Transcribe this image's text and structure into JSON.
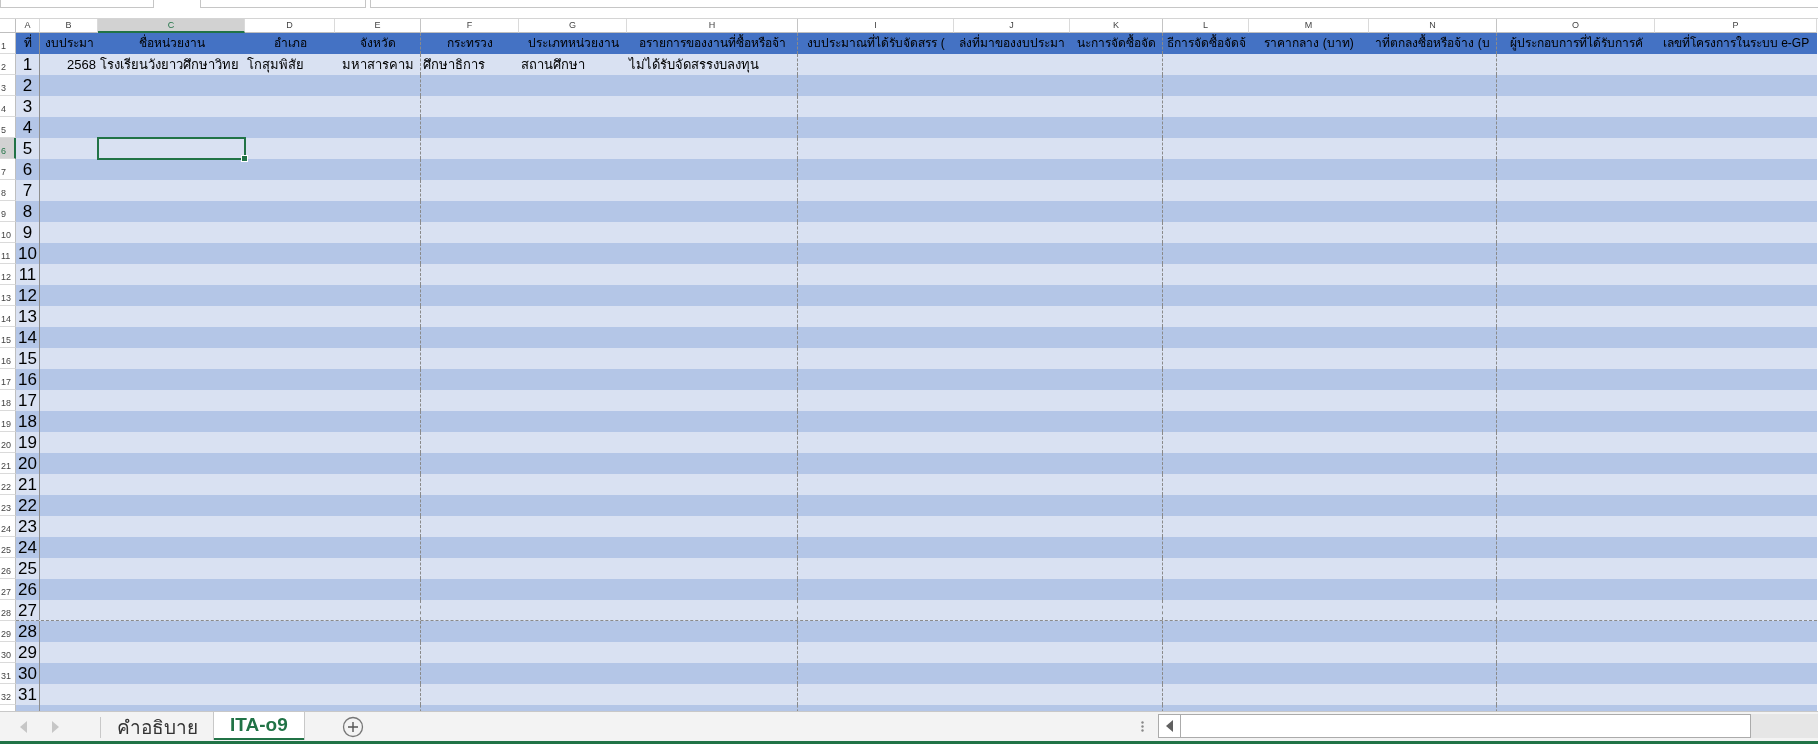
{
  "columns": [
    {
      "letter": "A",
      "selected": false,
      "page_break_after": false
    },
    {
      "letter": "B",
      "selected": false,
      "page_break_after": false
    },
    {
      "letter": "C",
      "selected": true,
      "page_break_after": false
    },
    {
      "letter": "D",
      "selected": false,
      "page_break_after": false
    },
    {
      "letter": "E",
      "selected": false,
      "page_break_after": true
    },
    {
      "letter": "F",
      "selected": false,
      "page_break_after": false
    },
    {
      "letter": "G",
      "selected": false,
      "page_break_after": false
    },
    {
      "letter": "H",
      "selected": false,
      "page_break_after": true
    },
    {
      "letter": "I",
      "selected": false,
      "page_break_after": false
    },
    {
      "letter": "J",
      "selected": false,
      "page_break_after": false
    },
    {
      "letter": "K",
      "selected": false,
      "page_break_after": true
    },
    {
      "letter": "L",
      "selected": false,
      "page_break_after": false
    },
    {
      "letter": "M",
      "selected": false,
      "page_break_after": false
    },
    {
      "letter": "N",
      "selected": false,
      "page_break_after": true
    },
    {
      "letter": "O",
      "selected": false,
      "page_break_after": false
    },
    {
      "letter": "P",
      "selected": false,
      "page_break_after": false
    }
  ],
  "rows": [
    {
      "number": "1",
      "kind": "header",
      "selected": false,
      "page_break_after": false,
      "cells": [
        "ที่",
        "งบประมา",
        "ชื่อหน่วยงาน",
        "อำเภอ",
        "จังหวัด",
        "กระทรวง",
        "ประเภทหน่วยงาน",
        "อรายการของงานที่ซื้อหรือจ้า",
        "งบประมาณที่ได้รับจัดสรร (",
        "ล่งที่มาของงบประมา",
        "นะการจัดซื้อจัด",
        "ธีการจัดซื้อจัดจ้",
        "ราคากลาง (บาท)",
        "าที่ตกลงซื้อหรือจ้าง (บ",
        "ผู้ประกอบการที่ได้รับการคั",
        "เลขที่โครงการในระบบ e-GP"
      ]
    },
    {
      "number": "2",
      "kind": "data",
      "selected": false,
      "page_break_after": false,
      "cells": [
        "1",
        "2568",
        "โรงเรียนวังยาวศึกษาวิทย",
        "โกสุมพิสัย",
        "มหาสารคาม",
        "ศึกษาธิการ",
        "สถานศึกษา",
        "ไม่ได้รับจัดสรรงบลงทุน"
      ]
    },
    {
      "number": "3",
      "kind": "data",
      "selected": false,
      "page_break_after": false,
      "cells": [
        "2"
      ]
    },
    {
      "number": "4",
      "kind": "data",
      "selected": false,
      "page_break_after": false,
      "cells": [
        "3"
      ]
    },
    {
      "number": "5",
      "kind": "data",
      "selected": false,
      "page_break_after": false,
      "cells": [
        "4"
      ]
    },
    {
      "number": "6",
      "kind": "data",
      "selected": true,
      "page_break_after": false,
      "cells": [
        "5"
      ]
    },
    {
      "number": "7",
      "kind": "data",
      "selected": false,
      "page_break_after": false,
      "cells": [
        "6"
      ]
    },
    {
      "number": "8",
      "kind": "data",
      "selected": false,
      "page_break_after": false,
      "cells": [
        "7"
      ]
    },
    {
      "number": "9",
      "kind": "data",
      "selected": false,
      "page_break_after": false,
      "cells": [
        "8"
      ]
    },
    {
      "number": "10",
      "kind": "data",
      "selected": false,
      "page_break_after": false,
      "cells": [
        "9"
      ]
    },
    {
      "number": "11",
      "kind": "data",
      "selected": false,
      "page_break_after": false,
      "cells": [
        "10"
      ]
    },
    {
      "number": "12",
      "kind": "data",
      "selected": false,
      "page_break_after": false,
      "cells": [
        "11"
      ]
    },
    {
      "number": "13",
      "kind": "data",
      "selected": false,
      "page_break_after": false,
      "cells": [
        "12"
      ]
    },
    {
      "number": "14",
      "kind": "data",
      "selected": false,
      "page_break_after": false,
      "cells": [
        "13"
      ]
    },
    {
      "number": "15",
      "kind": "data",
      "selected": false,
      "page_break_after": false,
      "cells": [
        "14"
      ]
    },
    {
      "number": "16",
      "kind": "data",
      "selected": false,
      "page_break_after": false,
      "cells": [
        "15"
      ]
    },
    {
      "number": "17",
      "kind": "data",
      "selected": false,
      "page_break_after": false,
      "cells": [
        "16"
      ]
    },
    {
      "number": "18",
      "kind": "data",
      "selected": false,
      "page_break_after": false,
      "cells": [
        "17"
      ]
    },
    {
      "number": "19",
      "kind": "data",
      "selected": false,
      "page_break_after": false,
      "cells": [
        "18"
      ]
    },
    {
      "number": "20",
      "kind": "data",
      "selected": false,
      "page_break_after": false,
      "cells": [
        "19"
      ]
    },
    {
      "number": "21",
      "kind": "data",
      "selected": false,
      "page_break_after": false,
      "cells": [
        "20"
      ]
    },
    {
      "number": "22",
      "kind": "data",
      "selected": false,
      "page_break_after": false,
      "cells": [
        "21"
      ]
    },
    {
      "number": "23",
      "kind": "data",
      "selected": false,
      "page_break_after": false,
      "cells": [
        "22"
      ]
    },
    {
      "number": "24",
      "kind": "data",
      "selected": false,
      "page_break_after": false,
      "cells": [
        "23"
      ]
    },
    {
      "number": "25",
      "kind": "data",
      "selected": false,
      "page_break_after": false,
      "cells": [
        "24"
      ]
    },
    {
      "number": "26",
      "kind": "data",
      "selected": false,
      "page_break_after": false,
      "cells": [
        "25"
      ]
    },
    {
      "number": "27",
      "kind": "data",
      "selected": false,
      "page_break_after": false,
      "cells": [
        "26"
      ]
    },
    {
      "number": "28",
      "kind": "data",
      "selected": false,
      "page_break_after": true,
      "cells": [
        "27"
      ]
    },
    {
      "number": "29",
      "kind": "data",
      "selected": false,
      "page_break_after": false,
      "cells": [
        "28"
      ]
    },
    {
      "number": "30",
      "kind": "data",
      "selected": false,
      "page_break_after": false,
      "cells": [
        "29"
      ]
    },
    {
      "number": "31",
      "kind": "data",
      "selected": false,
      "page_break_after": false,
      "cells": [
        "30"
      ]
    },
    {
      "number": "32",
      "kind": "data",
      "selected": false,
      "page_break_after": false,
      "cells": [
        "31"
      ]
    }
  ],
  "sheet_tabs": [
    {
      "label": "คำอธิบาย",
      "selected": false
    },
    {
      "label": "ITA-o9",
      "selected": true
    }
  ]
}
